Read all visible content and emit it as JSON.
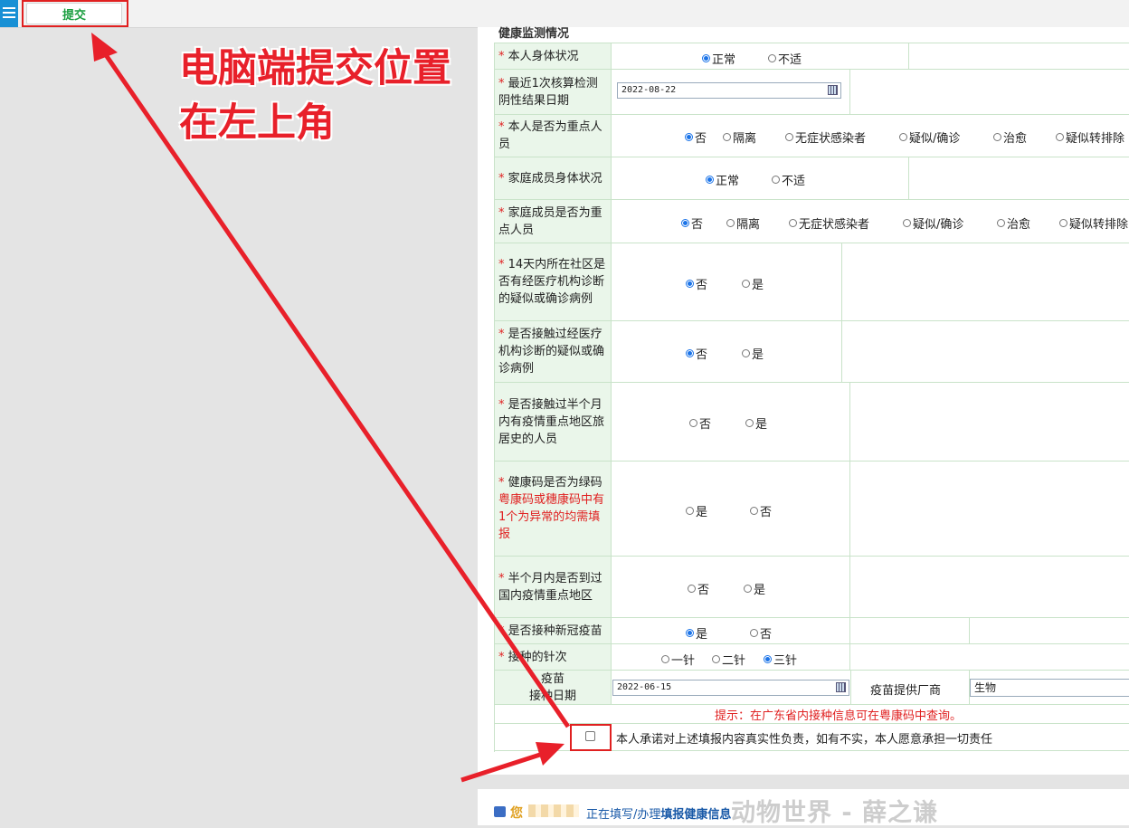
{
  "topbar": {
    "submit_label": "提交"
  },
  "section_title": "健康监测情况",
  "rows": {
    "self_status": {
      "label": "本人身体状况",
      "options": [
        "正常",
        "不适"
      ],
      "selected": "正常"
    },
    "last_test": {
      "label": "最近1次核算检测阴性结果日期",
      "date": "2022-08-22"
    },
    "self_key": {
      "label": "本人是否为重点人员",
      "options": [
        "否",
        "隔离",
        "无症状感染者",
        "疑似/确诊",
        "治愈",
        "疑似转排除"
      ],
      "selected": "否"
    },
    "family_status": {
      "label": "家庭成员身体状况",
      "options": [
        "正常",
        "不适"
      ],
      "selected": "正常"
    },
    "family_key": {
      "label": "家庭成员是否为重点人员",
      "options": [
        "否",
        "隔离",
        "无症状感染者",
        "疑似/确诊",
        "治愈",
        "疑似转排除"
      ],
      "selected": "否"
    },
    "community": {
      "label": "14天内所在社区是否有经医疗机构诊断的疑似或确诊病例",
      "options": [
        "否",
        "是"
      ],
      "selected": "否"
    },
    "contact": {
      "label": "是否接触过经医疗机构诊断的疑似或确诊病例",
      "options": [
        "否",
        "是"
      ],
      "selected": "否"
    },
    "travel": {
      "label": "是否接触过半个月内有疫情重点地区旅居史的人员",
      "options": [
        "否",
        "是"
      ],
      "selected": ""
    },
    "green_code": {
      "label": "健康码是否为绿码",
      "note": "粤康码或穗康码中有1个为异常的均需填报",
      "options": [
        "是",
        "否"
      ],
      "selected": ""
    },
    "abroad": {
      "label": "半个月内是否到过国内疫情重点地区",
      "options": [
        "否",
        "是"
      ],
      "selected": ""
    },
    "vaccinated": {
      "label": "是否接种新冠疫苗",
      "options": [
        "是",
        "否"
      ],
      "selected": "是"
    },
    "doses": {
      "label": "接种的针次",
      "options": [
        "一针",
        "二针",
        "三针"
      ],
      "selected": "三针"
    },
    "vaccine_date": {
      "label_line1": "疫苗",
      "label_line2": "接种日期",
      "date": "2022-06-15",
      "maker_label": "疫苗提供厂商",
      "maker_value": "生物"
    }
  },
  "tip": "提示：在广东省内接种信息可在粤康码中查询。",
  "commitment": "本人承诺对上述填报内容真实性负责，如有不实，本人愿意承担一切责任",
  "bottom": {
    "greet": "您",
    "status_prefix": "正在填写/办理",
    "status_bold": "填报健康信息"
  },
  "watermark": "动物世界 - 薛之谦",
  "annotation": {
    "line1": "电脑端提交位置",
    "line2": "在左上角"
  },
  "colors": {
    "accent_red": "#e02020",
    "label_bg": "#eaf6ea",
    "radio_blue": "#1a73e8",
    "submit_green": "#1a9e3f"
  }
}
